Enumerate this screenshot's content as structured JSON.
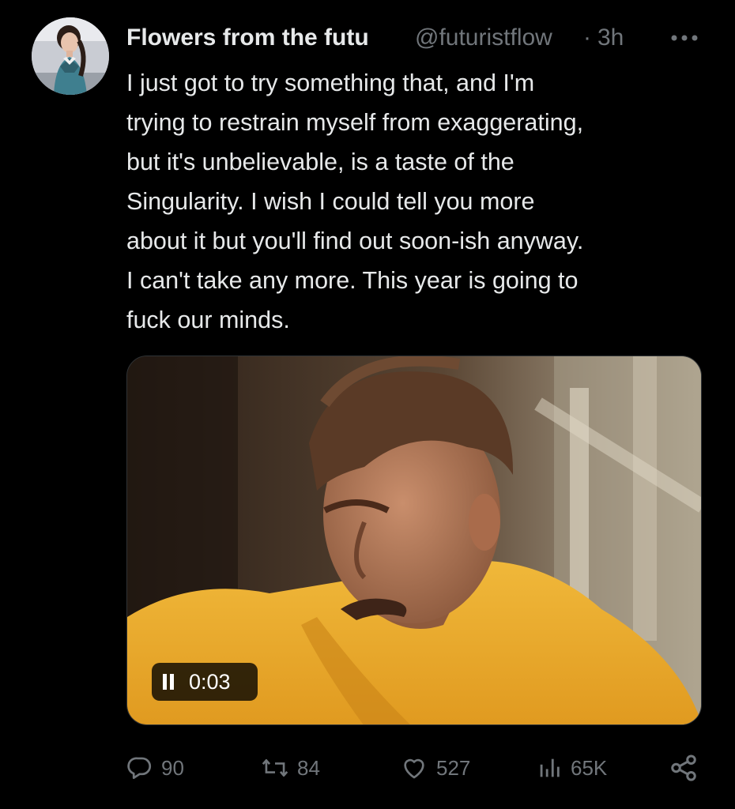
{
  "tweet": {
    "display_name": "Flowers from the futu",
    "handle": "@futuristflow",
    "separator": "·",
    "time": "3h",
    "text": "I just got to try something that, and I'm\ntrying to restrain myself from exaggerating,\nbut it's unbelievable, is a taste of the\nSingularity. I wish I could tell you more\nabout it but you'll find out soon-ish anyway.\nI can't take any more. This year is going to\nfuck our minds."
  },
  "media": {
    "type": "video",
    "playback_state": "playing",
    "elapsed": "0:03"
  },
  "actions": {
    "replies": "90",
    "reposts": "84",
    "likes": "527",
    "views": "65K"
  },
  "colors": {
    "background": "#000000",
    "primary_text": "#e7e9ea",
    "secondary_text": "#71767b"
  },
  "icons": {
    "more": "more-dots-icon",
    "pause": "pause-icon",
    "reply": "reply-bubble-icon",
    "repost": "repost-arrows-icon",
    "like": "heart-icon",
    "views": "bar-chart-icon",
    "share": "share-nodes-icon"
  }
}
